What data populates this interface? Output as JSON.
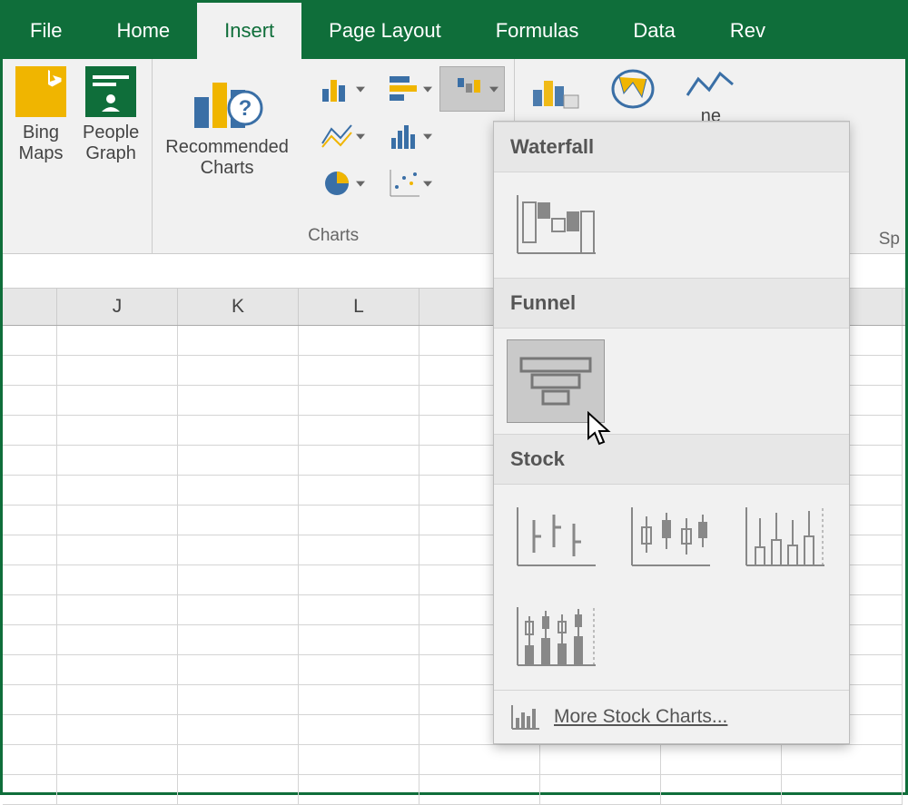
{
  "tabs": {
    "file": "File",
    "home": "Home",
    "insert": "Insert",
    "pageLayout": "Page Layout",
    "formulas": "Formulas",
    "data": "Data",
    "review": "Rev"
  },
  "ribbon": {
    "bingMaps": "Bing Maps",
    "peopleGraph": "People Graph",
    "recommended1": "Recommended",
    "recommended2": "Charts",
    "chartsGroup": "Charts",
    "line": "ne",
    "sp": "Sp"
  },
  "columns": [
    "",
    "J",
    "K",
    "L",
    "",
    "",
    "",
    ""
  ],
  "dropdown": {
    "waterfall": "Waterfall",
    "funnel": "Funnel",
    "stock": "Stock",
    "more": "More Stock Charts..."
  }
}
